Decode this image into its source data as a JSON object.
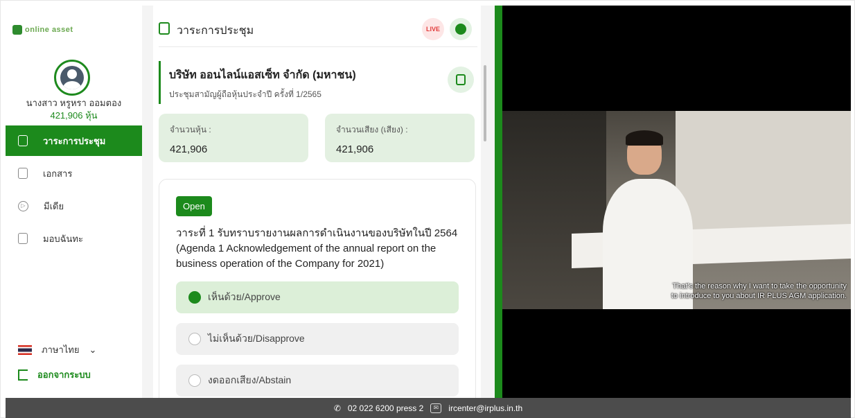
{
  "brand": {
    "logo_text": "online asset"
  },
  "user": {
    "name": "นางสาว หรูหรา ออมตอง",
    "shares": "421,906 หุ้น"
  },
  "nav": {
    "items": [
      {
        "label": "วาระการประชุม",
        "icon": "agenda-icon",
        "active": true
      },
      {
        "label": "เอกสาร",
        "icon": "folder-icon",
        "active": false
      },
      {
        "label": "มีเดีย",
        "icon": "play-icon",
        "active": false
      },
      {
        "label": "มอบฉันทะ",
        "icon": "proxy-doc-icon",
        "active": false
      }
    ]
  },
  "language": {
    "label": "ภาษาไทย",
    "chevron": "chevron-down-icon"
  },
  "logout": {
    "label": "ออกจากระบบ"
  },
  "header": {
    "title": "วาระการประชุม",
    "live_label": "LIVE"
  },
  "company": {
    "name": "บริษัท ออนไลน์แอสเซ็ท จำกัด (มหาชน)",
    "meeting": "ประชุมสามัญผู้ถือหุ้นประจำปี ครั้งที่ 1/2565"
  },
  "stats": [
    {
      "label": "จำนวนหุ้น :",
      "value": "421,906"
    },
    {
      "label": "จำนวนเสียง (เสียง) :",
      "value": "421,906"
    }
  ],
  "agenda": {
    "status": "Open",
    "text_th": "วาระที่ 1 รับทราบรายงานผลการดำเนินงานของบริษัทในปี 2564",
    "text_en": "(Agenda 1 Acknowledgement of the annual report on the business operation of the Company for 2021)",
    "options": [
      {
        "label": "เห็นด้วย/Approve",
        "selected": true
      },
      {
        "label": "ไม่เห็นด้วย/Disapprove",
        "selected": false
      },
      {
        "label": "งดออกเสียง/Abstain",
        "selected": false
      }
    ]
  },
  "video": {
    "subtitle_line1": "That's the reason why I want to take the opportunity",
    "subtitle_line2": "to introduce to you about IR PLUS AGM application."
  },
  "footer": {
    "phone": "02 022 6200 press 2",
    "email": "ircenter@irplus.in.th"
  },
  "colors": {
    "accent": "#1c8a1c",
    "stat_bg": "#e3f0e1",
    "footer_bg": "#4c4c4c"
  }
}
